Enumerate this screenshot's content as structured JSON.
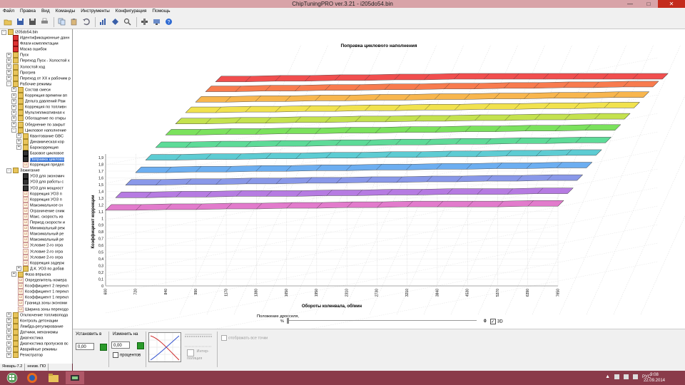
{
  "window": {
    "title": "ChipTuningPRO ver.3.21 - i205do54.bin"
  },
  "menu": [
    "Файл",
    "Правка",
    "Вид",
    "Команды",
    "Инструменты",
    "Конфигурация",
    "Помощь"
  ],
  "tree": {
    "items": [
      {
        "label": "i205do54.bin",
        "level": 0,
        "exp": "-",
        "icon": "folder"
      },
      {
        "label": "Идентификационные данн",
        "level": 1,
        "icon": "flag"
      },
      {
        "label": "Флаги комплектации",
        "level": 1,
        "icon": "flag"
      },
      {
        "label": "Маска ошибок",
        "level": 1,
        "icon": "flag"
      },
      {
        "label": "Пуск",
        "level": 1,
        "exp": "+",
        "icon": "folder"
      },
      {
        "label": "Переход Пуск - Холостой х",
        "level": 1,
        "exp": "+",
        "icon": "folder"
      },
      {
        "label": "Холостой ход",
        "level": 1,
        "exp": "+",
        "icon": "folder"
      },
      {
        "label": "Прогрев",
        "level": 1,
        "exp": "+",
        "icon": "folder"
      },
      {
        "label": "Переход от ХХ к рабочим р",
        "level": 1,
        "exp": "+",
        "icon": "folder"
      },
      {
        "label": "Рабочие режимы",
        "level": 1,
        "exp": "-",
        "icon": "folder"
      },
      {
        "label": "Состав смеси",
        "level": 2,
        "exp": "+",
        "icon": "folder"
      },
      {
        "label": "Коррекция времени вп",
        "level": 2,
        "exp": "+",
        "icon": "folder"
      },
      {
        "label": "Дельта давлений Рам",
        "level": 2,
        "exp": "+",
        "icon": "folder"
      },
      {
        "label": "Коррекция по топливн",
        "level": 2,
        "exp": "+",
        "icon": "folder"
      },
      {
        "label": "Мультипликативная к",
        "level": 2,
        "exp": "+",
        "icon": "folder"
      },
      {
        "label": "Обогащение по откры",
        "level": 2,
        "exp": "+",
        "icon": "folder"
      },
      {
        "label": "Обеднение по закрыт",
        "level": 2,
        "exp": "+",
        "icon": "folder"
      },
      {
        "label": "Цикловое наполнение",
        "level": 2,
        "exp": "-",
        "icon": "folder"
      },
      {
        "label": "Квантование GBC",
        "level": 3,
        "exp": "+",
        "icon": "folder"
      },
      {
        "label": "Динамическая кор",
        "level": 3,
        "exp": "+",
        "icon": "folder"
      },
      {
        "label": "Барокоррекция",
        "level": 3,
        "exp": "+",
        "icon": "folder"
      },
      {
        "label": "Базовое цикловое",
        "level": 3,
        "icon": "map"
      },
      {
        "label": "Поправка циклово",
        "level": 3,
        "icon": "map",
        "selected": true
      },
      {
        "label": "Коррекция предел",
        "level": 3,
        "icon": "num"
      },
      {
        "label": "Зажигание",
        "level": 1,
        "exp": "-",
        "icon": "folder"
      },
      {
        "label": "УОЗ для экономич",
        "level": 3,
        "icon": "map"
      },
      {
        "label": "УОЗ для работы с",
        "level": 3,
        "icon": "map"
      },
      {
        "label": "УОЗ для мощност",
        "level": 3,
        "icon": "map"
      },
      {
        "label": "Коррекция УОЗ п",
        "level": 3,
        "icon": "num"
      },
      {
        "label": "Коррекция УОЗ п",
        "level": 3,
        "icon": "num"
      },
      {
        "label": "Максимальное сн",
        "level": 3,
        "icon": "num"
      },
      {
        "label": "Ограничение сниж",
        "level": 3,
        "icon": "num"
      },
      {
        "label": "Макс. скорость из",
        "level": 3,
        "icon": "num"
      },
      {
        "label": "Период скорости и",
        "level": 3,
        "icon": "num"
      },
      {
        "label": "Минимальный реж",
        "level": 3,
        "icon": "num"
      },
      {
        "label": "Максимальный ре",
        "level": 3,
        "icon": "num"
      },
      {
        "label": "Максимальный ре",
        "level": 3,
        "icon": "num"
      },
      {
        "label": "Условие 2-го огра",
        "level": 3,
        "icon": "num"
      },
      {
        "label": "Условие 2-го огра",
        "level": 3,
        "icon": "num"
      },
      {
        "label": "Условие 2-го огра",
        "level": 3,
        "icon": "num"
      },
      {
        "label": "Коррекция задерж",
        "level": 3,
        "icon": "num"
      },
      {
        "label": "Д.К. УОЗ по добав",
        "level": 3,
        "exp": "+",
        "icon": "folder"
      },
      {
        "label": "Фаза впрыска",
        "level": 2,
        "exp": "+",
        "icon": "folder"
      },
      {
        "label": "Определитель номера",
        "level": 2,
        "icon": "num"
      },
      {
        "label": "Коэффициент 2 перекл",
        "level": 2,
        "icon": "num"
      },
      {
        "label": "Коэффициент 1 перекл",
        "level": 2,
        "icon": "num"
      },
      {
        "label": "Коэффициент 1 перекл",
        "level": 2,
        "icon": "num"
      },
      {
        "label": "Граница зоны экономи",
        "level": 2,
        "icon": "num"
      },
      {
        "label": "Ширина зоны переходо",
        "level": 2,
        "icon": "num"
      },
      {
        "label": "Отключение топливопода",
        "level": 1,
        "exp": "+",
        "icon": "folder"
      },
      {
        "label": "Контроль детонации",
        "level": 1,
        "exp": "+",
        "icon": "folder"
      },
      {
        "label": "Лямбда-регулирование",
        "level": 1,
        "exp": "+",
        "icon": "folder"
      },
      {
        "label": "Датчики, механизмы",
        "level": 1,
        "exp": "+",
        "icon": "folder"
      },
      {
        "label": "Диагностика",
        "level": 1,
        "exp": "+",
        "icon": "folder"
      },
      {
        "label": "Диагностика пропусков вс",
        "level": 1,
        "exp": "+",
        "icon": "folder"
      },
      {
        "label": "Аварийные режимы",
        "level": 1,
        "exp": "+",
        "icon": "folder"
      },
      {
        "label": "Регистратор",
        "level": 1,
        "exp": "+",
        "icon": "folder"
      }
    ]
  },
  "status": {
    "firmware": "Январь-7.2",
    "state": "неизв. ПО"
  },
  "chart": {
    "title": "Поправка циклового наполнения"
  },
  "chart_data": {
    "type": "surface",
    "title": "Поправка циклового наполнения",
    "xlabel": "Обороты коленвала, об/мин",
    "ylabel": "Коэффициент коррекции",
    "zlabel": "Положение дросселя, %",
    "x": [
      600,
      720,
      840,
      990,
      1170,
      1380,
      1650,
      1950,
      2310,
      2730,
      3210,
      3840,
      4530,
      5370,
      6390,
      7650
    ],
    "ytick_labels": [
      "1",
      "1,1",
      "1,2",
      "1,3",
      "1,4",
      "1,5",
      "1,6",
      "1,7",
      "1,8",
      "1,9"
    ],
    "ylim": [
      0,
      1.9
    ],
    "yticks": [
      0,
      0.1,
      0.2,
      0.3,
      0.4,
      0.5,
      0.6,
      0.7,
      0.8,
      0.9,
      1,
      1.1,
      1.2,
      1.3,
      1.4,
      1.5,
      1.6,
      1.7,
      1.8,
      1.9
    ],
    "series": [
      {
        "values": [
          1.12,
          1.12,
          1.13,
          1.13,
          1.14,
          1.14,
          1.15,
          1.15,
          1.16,
          1.16,
          1.17,
          1.17,
          1.17,
          1.17,
          1.18,
          1.18
        ],
        "color": "#e070c8"
      },
      {
        "values": [
          1.2,
          1.2,
          1.21,
          1.21,
          1.22,
          1.22,
          1.22,
          1.23,
          1.23,
          1.24,
          1.24,
          1.25,
          1.25,
          1.25,
          1.26,
          1.26
        ],
        "color": "#b070e0"
      },
      {
        "values": [
          1.28,
          1.28,
          1.29,
          1.29,
          1.3,
          1.3,
          1.31,
          1.31,
          1.32,
          1.32,
          1.33,
          1.33,
          1.34,
          1.34,
          1.35,
          1.35
        ],
        "color": "#8090e8"
      },
      {
        "values": [
          1.36,
          1.36,
          1.37,
          1.37,
          1.38,
          1.38,
          1.39,
          1.39,
          1.4,
          1.4,
          1.41,
          1.41,
          1.42,
          1.42,
          1.43,
          1.43
        ],
        "color": "#60a8f0"
      },
      {
        "values": [
          1.44,
          1.44,
          1.45,
          1.45,
          1.46,
          1.46,
          1.47,
          1.47,
          1.48,
          1.48,
          1.49,
          1.49,
          1.5,
          1.5,
          1.51,
          1.51
        ],
        "color": "#50c8d0"
      },
      {
        "values": [
          1.52,
          1.52,
          1.53,
          1.53,
          1.54,
          1.54,
          1.55,
          1.55,
          1.56,
          1.56,
          1.57,
          1.57,
          1.58,
          1.58,
          1.59,
          1.59
        ],
        "color": "#50d890"
      },
      {
        "values": [
          1.6,
          1.6,
          1.61,
          1.61,
          1.62,
          1.62,
          1.63,
          1.63,
          1.64,
          1.64,
          1.65,
          1.65,
          1.66,
          1.66,
          1.67,
          1.67
        ],
        "color": "#70e050"
      },
      {
        "values": [
          1.66,
          1.66,
          1.67,
          1.67,
          1.68,
          1.68,
          1.69,
          1.69,
          1.7,
          1.7,
          1.71,
          1.71,
          1.72,
          1.72,
          1.73,
          1.73
        ],
        "color": "#c0e040"
      },
      {
        "values": [
          1.72,
          1.72,
          1.73,
          1.73,
          1.74,
          1.74,
          1.75,
          1.75,
          1.76,
          1.76,
          1.77,
          1.77,
          1.78,
          1.78,
          1.79,
          1.79
        ],
        "color": "#f0e040"
      },
      {
        "values": [
          1.77,
          1.77,
          1.78,
          1.78,
          1.79,
          1.79,
          1.8,
          1.8,
          1.81,
          1.81,
          1.82,
          1.82,
          1.83,
          1.83,
          1.84,
          1.84
        ],
        "color": "#f8b040"
      },
      {
        "values": [
          1.82,
          1.82,
          1.83,
          1.83,
          1.84,
          1.84,
          1.85,
          1.85,
          1.86,
          1.86,
          1.87,
          1.87,
          1.88,
          1.88,
          1.89,
          1.89
        ],
        "color": "#f87040"
      },
      {
        "values": [
          1.86,
          1.86,
          1.87,
          1.87,
          1.88,
          1.88,
          1.89,
          1.89,
          1.9,
          1.9,
          1.9,
          1.9,
          1.9,
          1.9,
          1.9,
          1.9
        ],
        "color": "#f04040"
      }
    ],
    "grid": true
  },
  "controls": {
    "throttle_label": "Положение дросселя,",
    "throttle_unit": "%",
    "slider_value": "0",
    "checkbox_3d": "3D",
    "set_label": "Установить в",
    "set_value": "0,00",
    "change_label": "Изменить на",
    "change_value": "0,00",
    "percent_label": "процентов",
    "interp_label": "Интер-поляция",
    "show_all_label": "отображать все точки"
  },
  "taskbar": {
    "lang": "РУС",
    "time": "9:08",
    "date": "22.09.2014"
  }
}
